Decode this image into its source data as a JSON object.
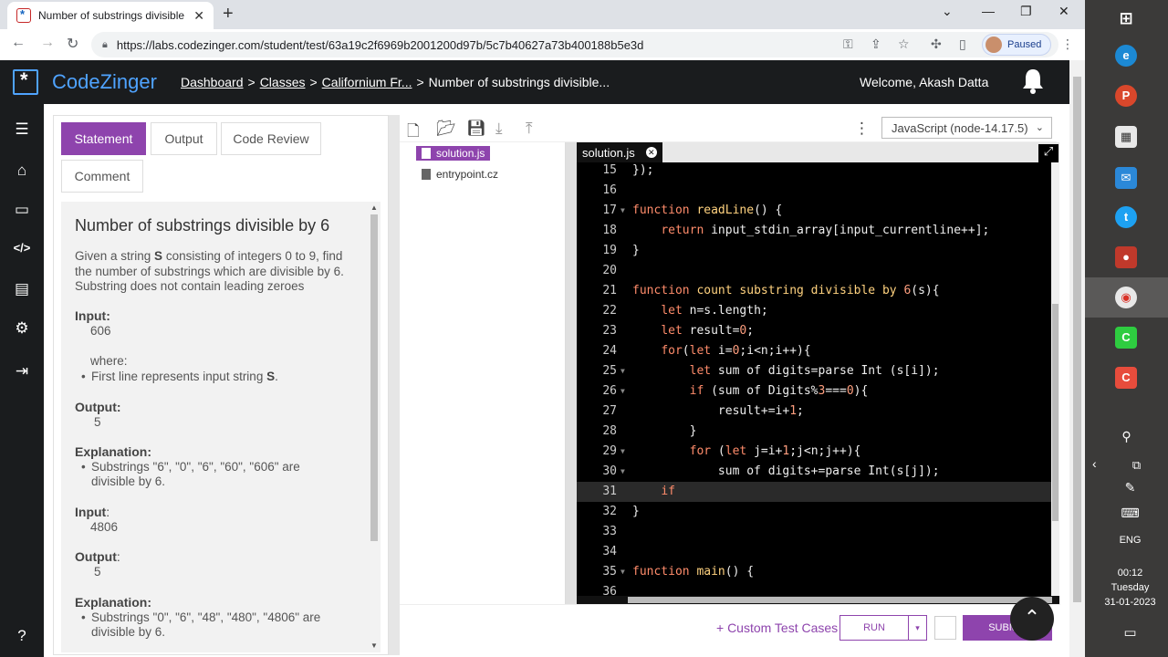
{
  "browser": {
    "tab_title": "Number of substrings divisible b",
    "url": "https://labs.codezinger.com/student/test/63a19c2f6969b2001200d97b/5c7b40627a73b400188b5e3d",
    "profile_status": "Paused"
  },
  "site": {
    "logo_text": "CodeZinger",
    "breadcrumb": [
      "Dashboard",
      "Classes",
      "Californium Fr...",
      "Number of substrings divisible..."
    ],
    "welcome": "Welcome, Akash Datta"
  },
  "statement_tabs": [
    "Statement",
    "Output",
    "Code Review",
    "Comment"
  ],
  "problem": {
    "title": "Number of substrings divisible by 6",
    "desc_line1": "Given a string ",
    "desc_S": "S",
    "desc_line1b": " consisting of integers 0 to 9, find",
    "desc_line2": "the number of substrings which are divisible by 6.",
    "desc_line3": "Substring does not contain leading zeroes",
    "input_label": "Input:",
    "input1": "606",
    "where": "where:",
    "where_bullet": "First line represents input string ",
    "where_S": "S",
    "where_end": ".",
    "output_label": "Output:",
    "output1": "5",
    "explanation_label": "Explanation:",
    "explanation1_a": "Substrings \"6\", \"0\", \"6\", \"60\", \"606\" are",
    "explanation1_b": "divisible by 6.",
    "input2_label": "Input",
    "input2_colon": ":",
    "input2": "4806",
    "output2_label": "Output",
    "output2_colon": ":",
    "output2": "5",
    "explanation2_a": "Substrings \"0\", \"6\", \"48\", \"480\", \"4806\" are",
    "explanation2_b": "divisible by 6."
  },
  "editor": {
    "language": "JavaScript (node-14.17.5)",
    "files": [
      "solution.js",
      "entrypoint.cz"
    ],
    "open_tab": "solution.js",
    "active_line": 31
  },
  "code_lines": [
    {
      "n": "15",
      "fold": false,
      "html": "});"
    },
    {
      "n": "16",
      "fold": false,
      "html": ""
    },
    {
      "n": "17",
      "fold": true,
      "html": "<span class='kw'>function</span> <span class='fn'>readLine</span>() {"
    },
    {
      "n": "18",
      "fold": false,
      "html": "    <span class='kw'>return</span> input_stdin_array[input_currentline++];"
    },
    {
      "n": "19",
      "fold": false,
      "html": "}"
    },
    {
      "n": "20",
      "fold": false,
      "html": ""
    },
    {
      "n": "21",
      "fold": false,
      "html": "<span class='kw'>function</span> <span class='fn'>count substring divisible by</span> <span class='num'>6</span>(s){"
    },
    {
      "n": "22",
      "fold": false,
      "html": "    <span class='kw'>let</span> n=s.length;"
    },
    {
      "n": "23",
      "fold": false,
      "html": "    <span class='kw'>let</span> result=<span class='num'>0</span>;"
    },
    {
      "n": "24",
      "fold": false,
      "html": "    <span class='kw'>for</span>(<span class='kw'>let</span> i=<span class='num'>0</span>;i&lt;n;i++){"
    },
    {
      "n": "25",
      "fold": true,
      "html": "        <span class='kw'>let</span> sum of digits=parse Int (s[i]);"
    },
    {
      "n": "26",
      "fold": true,
      "html": "        <span class='kw'>if</span> (sum of Digits%<span class='num'>3</span>===<span class='num'>0</span>){"
    },
    {
      "n": "27",
      "fold": false,
      "html": "            result+=i+<span class='num'>1</span>;"
    },
    {
      "n": "28",
      "fold": false,
      "html": "        }"
    },
    {
      "n": "29",
      "fold": true,
      "html": "        <span class='kw'>for</span> (<span class='kw'>let</span> j=i+<span class='num'>1</span>;j&lt;n;j++){"
    },
    {
      "n": "30",
      "fold": true,
      "html": "            sum of digits+=parse Int(s[j]);"
    },
    {
      "n": "31",
      "fold": false,
      "html": "    <span class='kw'>if</span> "
    },
    {
      "n": "32",
      "fold": false,
      "html": "}"
    },
    {
      "n": "33",
      "fold": false,
      "html": ""
    },
    {
      "n": "34",
      "fold": false,
      "html": ""
    },
    {
      "n": "35",
      "fold": true,
      "html": "<span class='kw'>function</span> <span class='fn'>main</span>() {"
    },
    {
      "n": "36",
      "fold": false,
      "html": ""
    }
  ],
  "actions": {
    "custom_test": "+ Custom Test Cases",
    "run": "RUN",
    "submit": "SUBMIT"
  },
  "taskbar": {
    "lang": "ENG",
    "time": "00:12",
    "day": "Tuesday",
    "date": "31-01-2023"
  },
  "colors": {
    "accent": "#8e44ad",
    "brand_blue": "#4fa3ff",
    "header_bg": "#1a1c1e"
  }
}
